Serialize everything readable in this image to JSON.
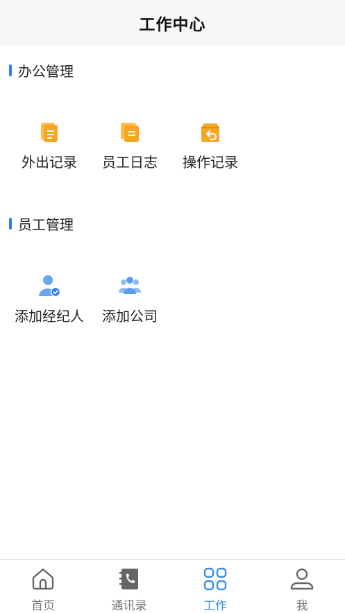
{
  "header": {
    "title": "工作中心"
  },
  "sections": [
    {
      "title": "办公管理",
      "items": [
        {
          "label": "外出记录",
          "icon": "document-icon"
        },
        {
          "label": "员工日志",
          "icon": "log-icon"
        },
        {
          "label": "操作记录",
          "icon": "undo-box-icon"
        }
      ]
    },
    {
      "title": "员工管理",
      "items": [
        {
          "label": "添加经纪人",
          "icon": "add-agent-icon"
        },
        {
          "label": "添加公司",
          "icon": "group-icon"
        }
      ]
    }
  ],
  "tabbar": {
    "items": [
      {
        "label": "首页",
        "icon": "home-icon",
        "active": false
      },
      {
        "label": "通讯录",
        "icon": "contacts-icon",
        "active": false
      },
      {
        "label": "工作",
        "icon": "grid-icon",
        "active": true
      },
      {
        "label": "我",
        "icon": "user-icon",
        "active": false
      }
    ]
  },
  "colors": {
    "accent": "#2f7cf6",
    "tab_active": "#3a8fde",
    "icon_orange": "#f5a623",
    "icon_blue": "#5b9ef0"
  }
}
